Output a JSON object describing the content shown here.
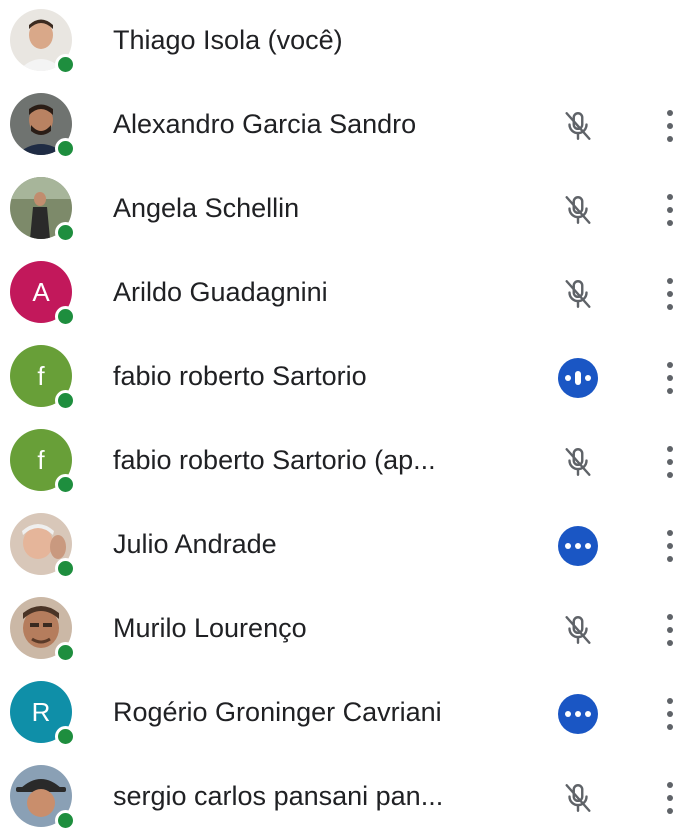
{
  "participants": [
    {
      "name": "Thiago Isola (você)",
      "avatar_type": "photo",
      "status": "none",
      "online": true
    },
    {
      "name": "Alexandro Garcia Sandro",
      "avatar_type": "photo",
      "status": "muted",
      "online": true
    },
    {
      "name": "Angela Schellin",
      "avatar_type": "photo",
      "status": "muted",
      "online": true
    },
    {
      "name": "Arildo Guadagnini",
      "avatar_type": "initial",
      "initial": "A",
      "avatar_color": "#c2185b",
      "status": "muted",
      "online": true
    },
    {
      "name": "fabio roberto Sartorio",
      "avatar_type": "initial",
      "initial": "f",
      "avatar_color": "#689f38",
      "status": "talking",
      "online": true
    },
    {
      "name": "fabio roberto Sartorio (ap...",
      "avatar_type": "initial",
      "initial": "f",
      "avatar_color": "#689f38",
      "status": "muted",
      "online": true
    },
    {
      "name": "Julio Andrade",
      "avatar_type": "photo",
      "status": "talking-idle",
      "online": true
    },
    {
      "name": "Murilo Lourenço",
      "avatar_type": "photo",
      "status": "muted",
      "online": true
    },
    {
      "name": "Rogério Groninger Cavriani",
      "avatar_type": "initial",
      "initial": "R",
      "avatar_color": "#0f8fa8",
      "status": "talking-idle",
      "online": true
    },
    {
      "name": "sergio carlos pansani pan...",
      "avatar_type": "photo",
      "status": "muted",
      "online": true
    }
  ],
  "colors": {
    "presence": "#1e8e3e",
    "talking_badge": "#1a56c4",
    "muted_icon": "#5f6368",
    "more_icon": "#5f6368"
  },
  "icons": {
    "muted": "mic-off-icon",
    "talking": "audio-level-icon",
    "more": "more-vert-icon"
  }
}
